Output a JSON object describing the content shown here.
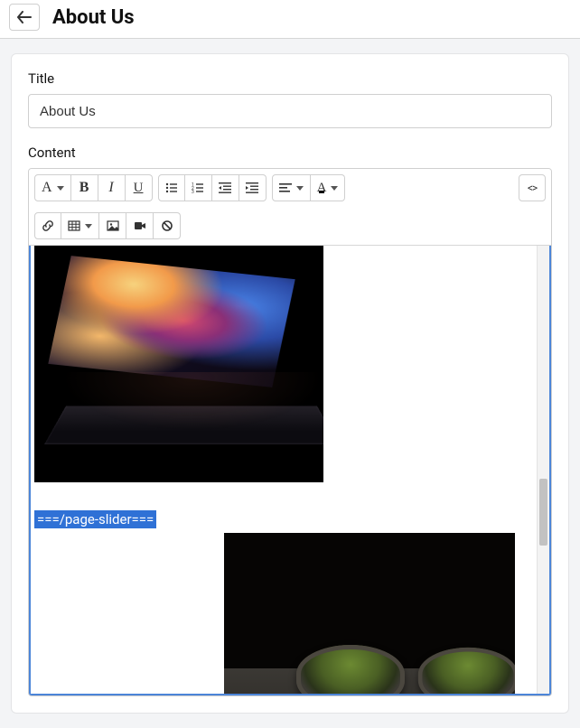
{
  "header": {
    "page_title": "About Us"
  },
  "form": {
    "title_label": "Title",
    "title_value": "About Us",
    "content_label": "Content"
  },
  "editor": {
    "slider_tag": "===/page-slider==="
  },
  "toolbar": {
    "font_letter": "A",
    "bold_letter": "B",
    "italic_letter": "I",
    "underline_letter": "U",
    "fontcolor_letter": "A",
    "code_symbol": "<>"
  }
}
